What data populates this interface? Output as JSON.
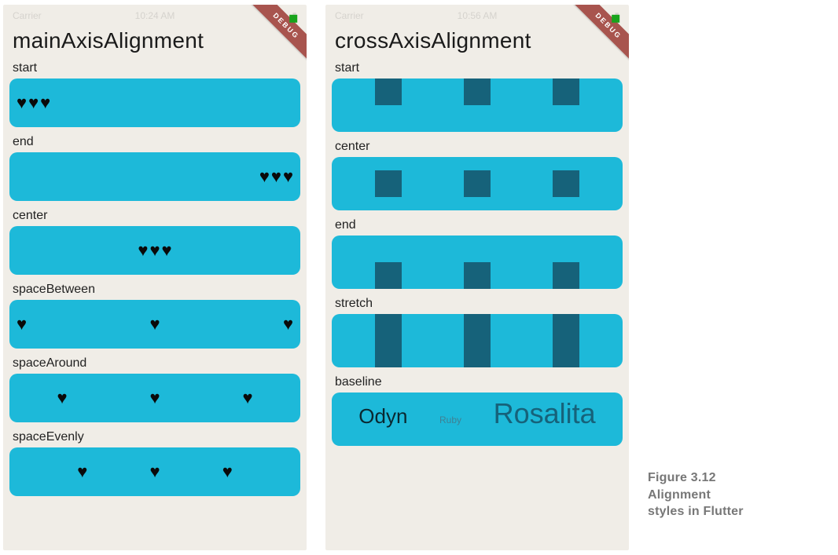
{
  "left_phone": {
    "status": {
      "carrier": "Carrier",
      "time": "10:24 AM",
      "battery_icon": "battery-icon"
    },
    "debug_banner": "DEBUG",
    "title": "mainAxisAlignment",
    "sections": {
      "start": "start",
      "end": "end",
      "center": "center",
      "spaceBetween": "spaceBetween",
      "spaceAround": "spaceAround",
      "spaceEvenly": "spaceEvenly"
    },
    "heart_glyph": "♥"
  },
  "right_phone": {
    "status": {
      "carrier": "Carrier",
      "time": "10:56 AM",
      "battery_icon": "battery-icon"
    },
    "debug_banner": "DEBUG",
    "title": "crossAxisAlignment",
    "sections": {
      "start": "start",
      "center": "center",
      "end": "end",
      "stretch": "stretch",
      "baseline": "baseline"
    },
    "baseline_names": {
      "a": "Odyn",
      "b": "Ruby",
      "c": "Rosalita"
    },
    "square_color": "#16627a"
  },
  "caption": {
    "title": "Figure 3.12",
    "line1": "Alignment",
    "line2": "styles in Flutter"
  }
}
